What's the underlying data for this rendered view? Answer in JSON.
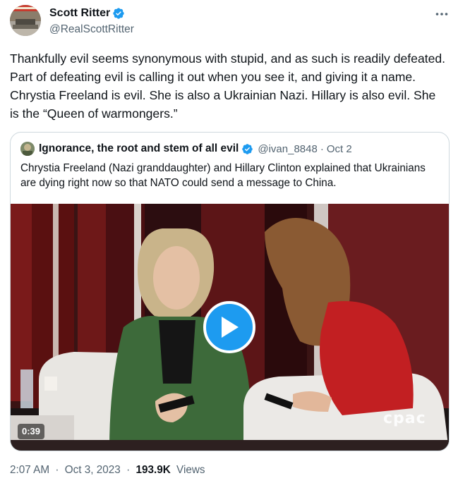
{
  "author": {
    "display_name": "Scott Ritter",
    "handle": "@RealScottRitter",
    "verified": true,
    "avatar_icon": "profile-photo"
  },
  "tweet": {
    "text": "Thankfully evil seems synonymous with stupid, and as such is readily defeated. Part of defeating evil is calling it out when you see it, and giving it a name. Chrystia Freeland is evil. She is also a Ukrainian Nazi. Hillary is also evil. She is the “Queen of warmongers.”",
    "time": "2:07 AM",
    "date": "Oct 3, 2023",
    "views_count": "193.9K",
    "views_label": "Views",
    "separator": "·"
  },
  "quoted_tweet": {
    "display_name": "Ignorance, the root and stem of all evil",
    "handle": "@ivan_8848",
    "separator": "·",
    "date": "Oct 2",
    "verified": true,
    "text": "Chrystia Freeland (Nazi granddaughter) and Hillary Clinton explained that Ukrainians are dying right now so that NATO could send a message to China.",
    "video": {
      "duration": "0:39",
      "watermark": "cpac",
      "play_icon": "play-icon"
    }
  },
  "colors": {
    "verified_blue": "#1d9bf0",
    "text_primary": "#0f1419",
    "text_secondary": "#536471",
    "border": "#cfd9de"
  }
}
